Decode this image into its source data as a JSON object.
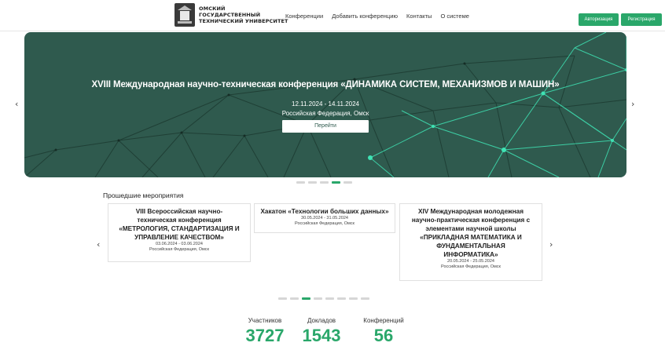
{
  "header": {
    "logo_lines": [
      "ОМСКИЙ",
      "ГОСУДАРСТВЕННЫЙ",
      "ТЕХНИЧЕСКИЙ УНИВЕРСИТЕТ"
    ],
    "nav": [
      "Конференции",
      "Добавить конференцию",
      "Контакты",
      "О системе"
    ],
    "auth_label": "Авторизация",
    "register_label": "Регистрация"
  },
  "banner": {
    "title": "XVIII Международная научно-техническая конференция «ДИНАМИКА СИСТЕМ, МЕХАНИЗМОВ И МАШИН»",
    "dates": "12.11.2024 - 14.11.2024",
    "place": "Российская Федерация, Омск",
    "button_label": "Перейти",
    "prev_icon": "‹",
    "next_icon": "›",
    "dots_total": 5,
    "dots_active_index": 3
  },
  "past_events": {
    "title": "Прошедшие мероприятия",
    "prev_icon": "‹",
    "next_icon": "›",
    "items": [
      {
        "title_lines": [
          "VIII Всероссийская научно-",
          "техническая конференция",
          "«МЕТРОЛОГИЯ, СТАНДАРТИЗАЦИЯ И",
          "УПРАВЛЕНИЕ КАЧЕСТВОМ»"
        ],
        "dates": "03.06.2024 - 03.06.2024",
        "place": "Российская Федерация, Омск"
      },
      {
        "title_lines": [
          "Хакатон «Технологии больших данных»"
        ],
        "dates": "30.05.2024 - 31.05.2024",
        "place": "Российская Федерация, Омск"
      },
      {
        "title_lines": [
          "XIV Международная молодежная",
          "научно-практическая конференция с",
          "элементами научной школы",
          "«ПРИКЛАДНАЯ МАТЕМАТИКА И",
          "ФУНДАМЕНТАЛЬНАЯ",
          "ИНФОРМАТИКА»"
        ],
        "dates": "20.05.2024 - 25.05.2024",
        "place": "Российская Федерация, Омск"
      }
    ],
    "dots_total": 8,
    "dots_active_index": 2
  },
  "stats": [
    {
      "label": "Участников",
      "value": "3727"
    },
    {
      "label": "Докладов",
      "value": "1543"
    },
    {
      "label": "Конференций",
      "value": "56"
    }
  ],
  "colors": {
    "accent": "#2aa76a",
    "banner_bg": "#2f5a4e",
    "network_line": "#1f3f35",
    "network_glow": "#3fe3b4"
  }
}
